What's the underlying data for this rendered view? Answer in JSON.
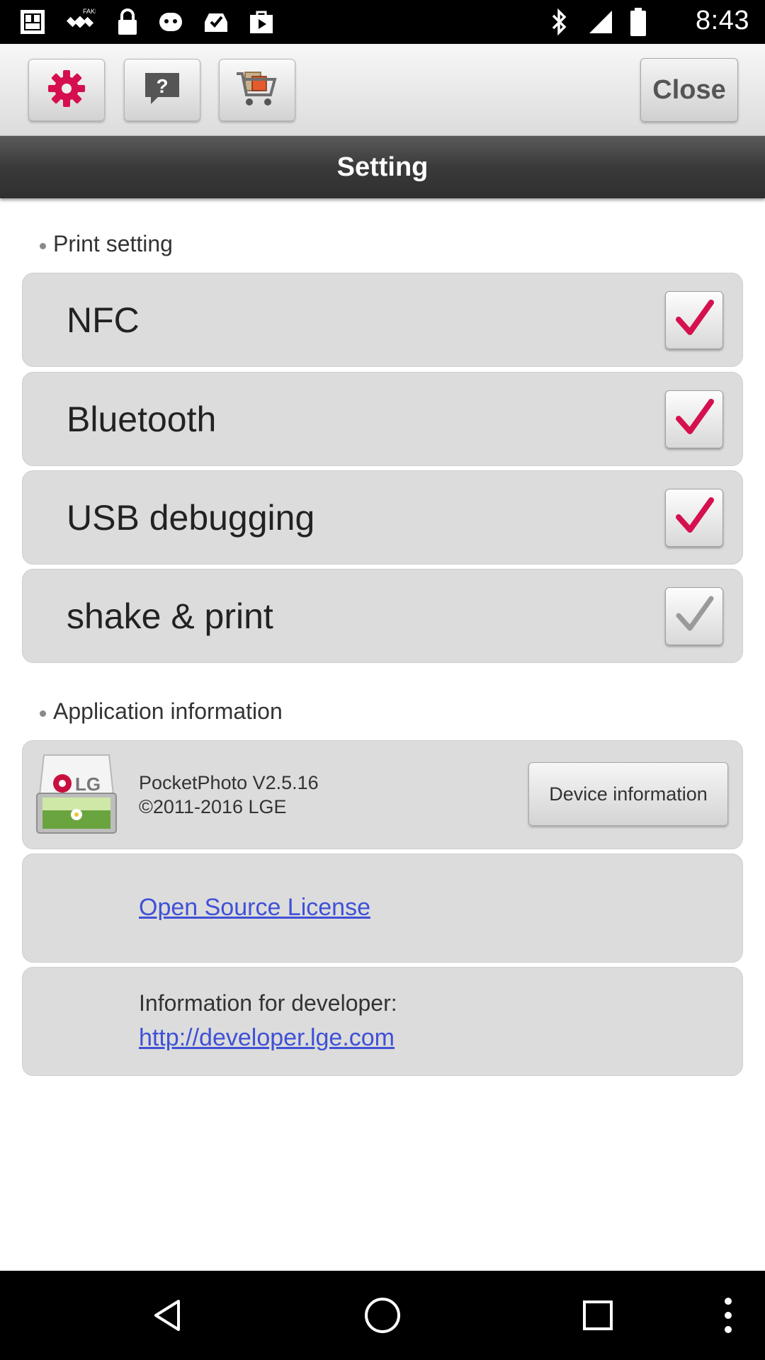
{
  "status_bar": {
    "time": "8:43",
    "icons": [
      "photo-icon",
      "fake-gps-icon",
      "lock-icon",
      "android-icon",
      "inbox-check-icon",
      "play-store-icon",
      "bluetooth-icon",
      "cellular-signal-icon",
      "battery-icon"
    ]
  },
  "toolbar": {
    "settings_icon": "gear-icon",
    "help_icon": "help-icon",
    "cart_icon": "cart-icon",
    "close_label": "Close"
  },
  "title": "Setting",
  "print_section": {
    "label": "Print setting",
    "items": [
      {
        "label": "NFC",
        "checked": true
      },
      {
        "label": "Bluetooth",
        "checked": true
      },
      {
        "label": "USB debugging",
        "checked": true
      },
      {
        "label": "shake & print",
        "checked": false
      }
    ]
  },
  "app_section": {
    "label": "Application information",
    "app_name": "PocketPhoto V2.5.16",
    "copyright": "©2011-2016 LGE",
    "logo_text": "LG",
    "device_button": "Device information",
    "open_source": "Open Source License",
    "developer_label": "Information for developer:",
    "developer_link": "http://developer.lge.com"
  },
  "colors": {
    "check_active": "#d5104f",
    "check_inactive": "#9a9a9a",
    "link": "#3f51d6"
  }
}
